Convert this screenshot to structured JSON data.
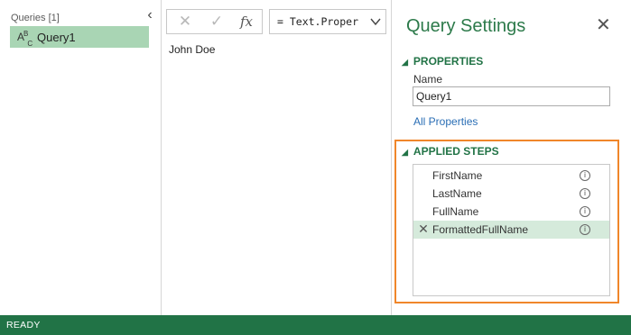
{
  "queries_pane": {
    "header": "Queries [1]",
    "query_type_icon": "ABC",
    "items": [
      {
        "label": "Query1",
        "selected": true
      }
    ]
  },
  "formula_bar": {
    "cancel_icon": "✕",
    "commit_icon": "✓",
    "fx_icon": "fx",
    "formula": "= Text.Proper"
  },
  "preview": {
    "value": "John Doe"
  },
  "settings": {
    "title": "Query Settings",
    "close_icon": "✕",
    "properties_heading": "PROPERTIES",
    "name_label": "Name",
    "name_value": "Query1",
    "all_properties_link": "All Properties",
    "applied_steps_heading": "APPLIED STEPS",
    "steps": [
      {
        "label": "FirstName"
      },
      {
        "label": "LastName"
      },
      {
        "label": "FullName"
      },
      {
        "label": "FormattedFullName",
        "selected": true
      }
    ],
    "highlight_color": "#f0862a"
  },
  "status_bar": {
    "text": "READY",
    "color": "#217346"
  }
}
